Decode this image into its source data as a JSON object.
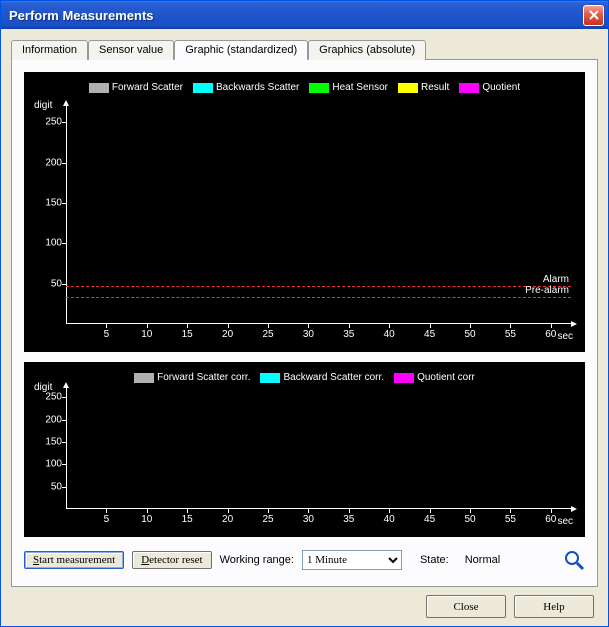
{
  "window": {
    "title": "Perform Measurements"
  },
  "tabs": {
    "t0": "Information",
    "t1": "Sensor value",
    "t2": "Graphic (standardized)",
    "t3": "Graphics (absolute)",
    "active_index": 2
  },
  "chart_data": [
    {
      "type": "line",
      "title": "",
      "ylabel": "digit",
      "xlabel": "sec",
      "xlim": [
        0,
        60
      ],
      "ylim": [
        0,
        260
      ],
      "xticks": [
        5,
        10,
        15,
        20,
        25,
        30,
        35,
        40,
        45,
        50,
        55,
        60
      ],
      "yticks": [
        50,
        100,
        150,
        200,
        250
      ],
      "series": [
        {
          "name": "Forward Scatter",
          "color": "#b0b0b0",
          "values": []
        },
        {
          "name": "Backwards Scatter",
          "color": "#00ffff",
          "values": []
        },
        {
          "name": "Heat Sensor",
          "color": "#00ff00",
          "values": []
        },
        {
          "name": "Result",
          "color": "#ffff00",
          "values": []
        },
        {
          "name": "Quotient",
          "color": "#ff00ff",
          "values": []
        }
      ],
      "thresholds": [
        {
          "label": "Alarm",
          "value": 47,
          "color": "#ee3333"
        },
        {
          "label": "Pre-alarm",
          "value": 33,
          "color": "#ee3333"
        }
      ]
    },
    {
      "type": "line",
      "title": "",
      "ylabel": "digit",
      "xlabel": "sec",
      "xlim": [
        0,
        60
      ],
      "ylim": [
        0,
        260
      ],
      "xticks": [
        5,
        10,
        15,
        20,
        25,
        30,
        35,
        40,
        45,
        50,
        55,
        60
      ],
      "yticks": [
        50,
        100,
        150,
        200,
        250
      ],
      "series": [
        {
          "name": "Forward Scatter corr.",
          "color": "#b0b0b0",
          "values": []
        },
        {
          "name": "Backward Scatter corr.",
          "color": "#00ffff",
          "values": []
        },
        {
          "name": "Quotient corr",
          "color": "#ff00ff",
          "values": []
        }
      ],
      "thresholds": []
    }
  ],
  "controls": {
    "start_label": "Start measurement",
    "detector_reset_label": "Detector reset",
    "working_range_label": "Working range:",
    "working_range_value": "1 Minute",
    "state_label": "State:",
    "state_value": "Normal"
  },
  "buttons": {
    "close": "Close",
    "help": "Help"
  }
}
